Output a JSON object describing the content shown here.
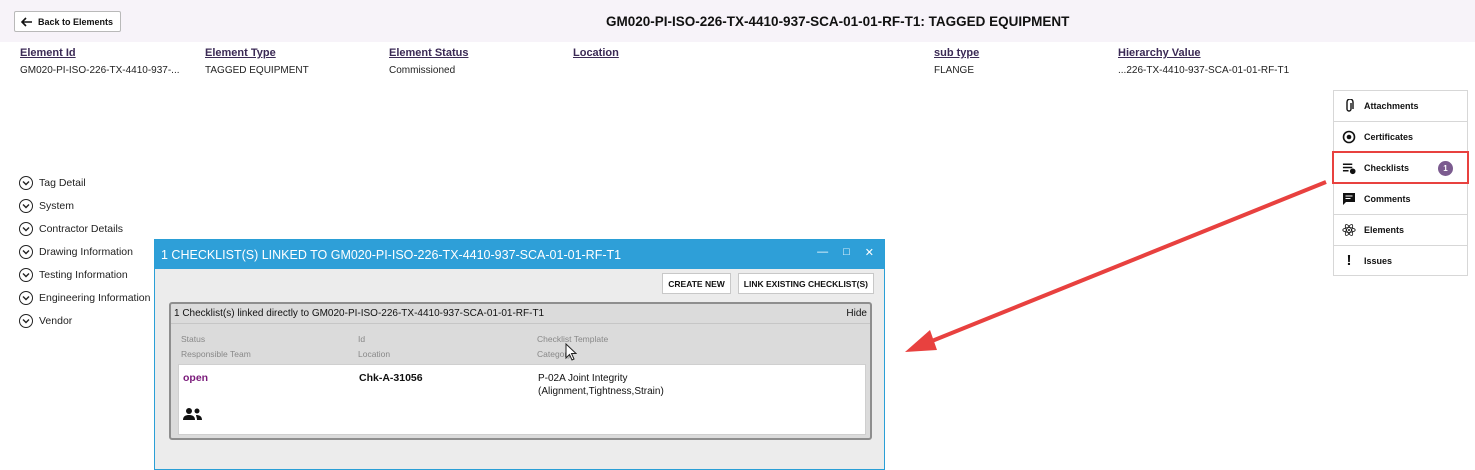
{
  "header": {
    "back_label": "Back to Elements",
    "title": "GM020-PI-ISO-226-TX-4410-937-SCA-01-01-RF-T1:  TAGGED EQUIPMENT"
  },
  "fields": {
    "element_id": {
      "label": "Element Id",
      "value": "GM020-PI-ISO-226-TX-4410-937-..."
    },
    "element_type": {
      "label": "Element Type",
      "value": "TAGGED EQUIPMENT"
    },
    "element_status": {
      "label": "Element Status",
      "value": "Commissioned"
    },
    "location": {
      "label": "Location",
      "value": ""
    },
    "sub_type": {
      "label": "sub type",
      "value": "FLANGE"
    },
    "hierarchy": {
      "label": "Hierarchy Value",
      "value": "...226-TX-4410-937-SCA-01-01-RF-T1"
    }
  },
  "sections": [
    "Tag Detail",
    "System",
    "Contractor Details",
    "Drawing Information",
    "Testing Information",
    "Engineering Information",
    "Vendor"
  ],
  "side_panel": {
    "attachments": "Attachments",
    "certificates": "Certificates",
    "checklists": "Checklists",
    "checklists_badge": "1",
    "comments": "Comments",
    "elements": "Elements",
    "issues": "Issues"
  },
  "dialog": {
    "title": "1 CHECKLIST(S) LINKED TO GM020-PI-ISO-226-TX-4410-937-SCA-01-01-RF-T1",
    "create_new": "CREATE NEW",
    "link_existing": "LINK EXISTING CHECKLIST(S)",
    "panel_title": "1 Checklist(s) linked directly to GM020-PI-ISO-226-TX-4410-937-SCA-01-01-RF-T1",
    "hide": "Hide",
    "headers": {
      "status": "Status",
      "id": "Id",
      "template": "Checklist Template",
      "team": "Responsible Team",
      "location": "Location",
      "category": "Category"
    },
    "row": {
      "status": "open",
      "id": "Chk-A-31056",
      "template": "P-02A Joint Integrity (Alignment,Tightness,Strain)"
    }
  },
  "colors": {
    "accent": "#2e9fd8",
    "highlight": "#e8413f",
    "badge": "#7b5b8f",
    "status_open": "#7a1a7a"
  }
}
